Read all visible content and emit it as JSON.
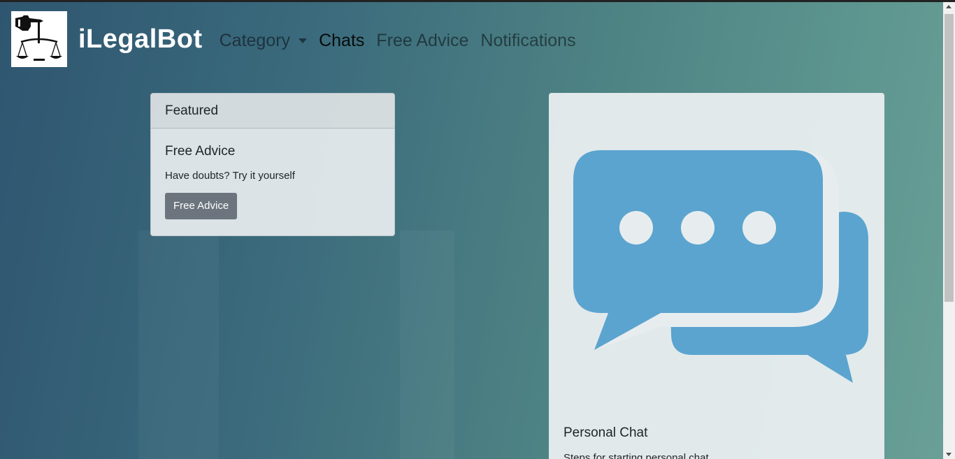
{
  "brand": {
    "name": "iLegalBot",
    "logo_icon": "pointing-hand-scales-icon"
  },
  "nav": {
    "items": [
      {
        "label": "Category",
        "dropdown": true
      },
      {
        "label": "Chats",
        "active": true
      },
      {
        "label": "Free Advice"
      },
      {
        "label": "Notifications"
      }
    ]
  },
  "featured_card": {
    "header": "Featured",
    "title": "Free Advice",
    "text": "Have doubts? Try it yourself",
    "button_label": "Free Advice"
  },
  "chat_card": {
    "image_icon": "chat-bubbles-icon",
    "title": "Personal Chat",
    "text": "Steps for starting personal chat"
  },
  "colors": {
    "chat_icon": "#5ba4cf",
    "button_secondary": "#6c757d",
    "brand_text": "#ffffff"
  }
}
